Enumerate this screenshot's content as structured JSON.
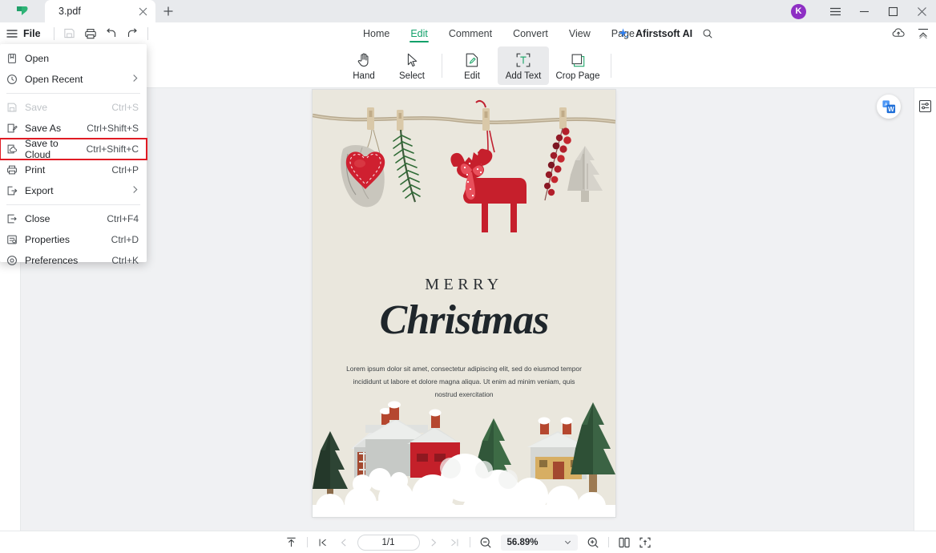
{
  "window": {
    "logo_icon": "afirstsoft-leaf-logo",
    "tab": {
      "label": "3.pdf",
      "close_icon": "close-icon"
    },
    "new_tab_icon": "plus-icon",
    "avatar_initial": "K",
    "menu_icon": "hamburger-menu-icon",
    "minimize_icon": "minimize-icon",
    "maximize_icon": "maximize-icon",
    "close_icon": "close-icon"
  },
  "menubar": {
    "file_label": "File",
    "file_icon": "hamburger-menu-icon",
    "quick_actions": [
      {
        "name": "save-icon",
        "label": "Save",
        "disabled": true
      },
      {
        "name": "print-icon",
        "label": "Print",
        "disabled": false
      },
      {
        "name": "undo-icon",
        "label": "Undo",
        "disabled": false
      },
      {
        "name": "redo-icon",
        "label": "Redo",
        "disabled": false
      }
    ]
  },
  "ribbon": {
    "tabs": [
      {
        "label": "Home",
        "active": false
      },
      {
        "label": "Edit",
        "active": true
      },
      {
        "label": "Comment",
        "active": false
      },
      {
        "label": "Convert",
        "active": false
      },
      {
        "label": "View",
        "active": false
      },
      {
        "label": "Page",
        "active": false
      }
    ],
    "ai_label": "Afirstsoft AI",
    "ai_icon": "sparkle-icon",
    "search_icon": "search-icon",
    "cloud_icon": "cloud-upload-icon",
    "collapse_icon": "collapse-ribbon-icon",
    "accent_color": "#12a06a"
  },
  "toolbar": {
    "tools": [
      {
        "label": "Hand",
        "icon": "hand-icon",
        "active": false
      },
      {
        "label": "Select",
        "icon": "cursor-select-icon",
        "active": false
      },
      {
        "label": "Edit",
        "icon": "edit-document-icon",
        "active": false
      },
      {
        "label": "Add Text",
        "icon": "add-text-icon",
        "active": true
      },
      {
        "label": "Crop Page",
        "icon": "crop-page-icon",
        "active": false
      }
    ]
  },
  "file_menu": {
    "items": [
      {
        "label": "Open",
        "shortcut": "",
        "icon": "open-file-icon",
        "disabled": false,
        "submenu": false,
        "highlighted": false
      },
      {
        "label": "Open Recent",
        "shortcut": "",
        "icon": "clock-recent-icon",
        "disabled": false,
        "submenu": true,
        "highlighted": false
      },
      {
        "separator_after": true,
        "label": "",
        "shortcut": "",
        "icon": "",
        "disabled": false,
        "submenu": false,
        "highlighted": false
      },
      {
        "label": "Save",
        "shortcut": "Ctrl+S",
        "icon": "save-disk-icon",
        "disabled": true,
        "submenu": false,
        "highlighted": false
      },
      {
        "label": "Save As",
        "shortcut": "Ctrl+Shift+S",
        "icon": "save-as-icon",
        "disabled": false,
        "submenu": false,
        "highlighted": false
      },
      {
        "label": "Save to Cloud",
        "shortcut": "Ctrl+Shift+C",
        "icon": "save-to-cloud-icon",
        "disabled": false,
        "submenu": false,
        "highlighted": true
      },
      {
        "label": "Print",
        "shortcut": "Ctrl+P",
        "icon": "print-icon",
        "disabled": false,
        "submenu": false,
        "highlighted": false
      },
      {
        "label": "Export",
        "shortcut": "",
        "icon": "export-icon",
        "disabled": false,
        "submenu": true,
        "highlighted": false
      },
      {
        "separator_after": true,
        "label": "",
        "shortcut": "",
        "icon": "",
        "disabled": false,
        "submenu": false,
        "highlighted": false
      },
      {
        "label": "Close",
        "shortcut": "Ctrl+F4",
        "icon": "close-document-icon",
        "disabled": false,
        "submenu": false,
        "highlighted": false
      },
      {
        "label": "Properties",
        "shortcut": "Ctrl+D",
        "icon": "properties-icon",
        "disabled": false,
        "submenu": false,
        "highlighted": false
      },
      {
        "label": "Preferences",
        "shortcut": "Ctrl+K",
        "icon": "preferences-gear-icon",
        "disabled": false,
        "submenu": false,
        "highlighted": false
      }
    ],
    "highlight_color": "#e01b24"
  },
  "document": {
    "heading_small": "MERRY",
    "heading_large": "Christmas",
    "body_text": "Lorem ipsum dolor sit amet, consectetur adipiscing elit, sed do eiusmod tempor incididunt ut labore et dolore magna aliqua. Ut enim ad minim veniam, quis nostrud exercitation",
    "page_background": "#eae7dd",
    "art_top": "christmas-ornaments-hanging-photo",
    "art_bottom": "snowy-village-miniature-photo",
    "word_badge_icon": "convert-to-word-icon"
  },
  "sidebar_right": {
    "panel_icon": "page-settings-panel-icon"
  },
  "statusbar": {
    "fit_top_icon": "scroll-to-top-icon",
    "first_page_icon": "first-page-icon",
    "prev_page_icon": "previous-page-icon",
    "page_value": "1/1",
    "next_page_icon": "next-page-icon",
    "last_page_icon": "last-page-icon",
    "zoom_out_icon": "zoom-out-icon",
    "zoom_value": "56.89%",
    "zoom_dropdown_icon": "chevron-down-icon",
    "zoom_in_icon": "zoom-in-icon",
    "dual_page_icon": "dual-page-view-icon",
    "fit_screen_icon": "fit-to-screen-icon"
  }
}
